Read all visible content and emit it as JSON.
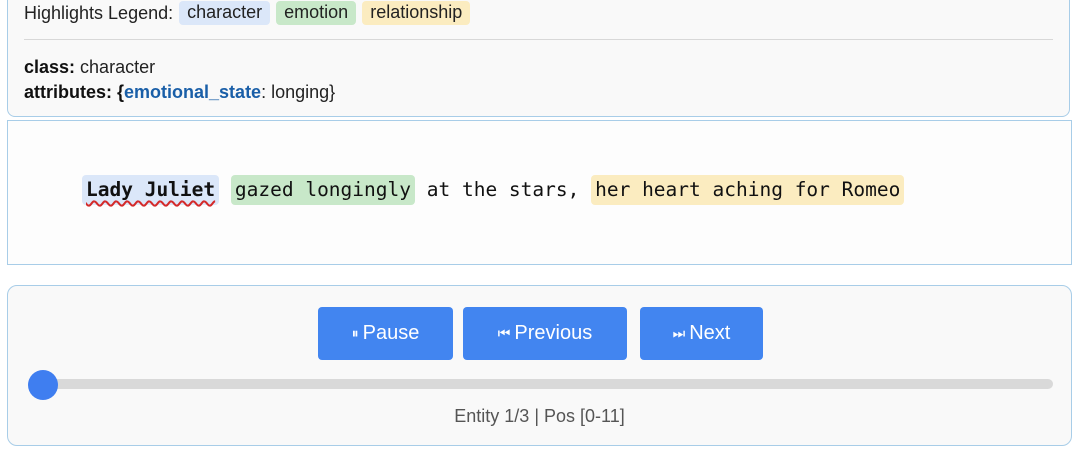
{
  "legend": {
    "label": "Highlights Legend:",
    "items": [
      {
        "label": "character",
        "color": "#dbe7f9"
      },
      {
        "label": "emotion",
        "color": "#c8e8c9"
      },
      {
        "label": "relationship",
        "color": "#fbecc0"
      }
    ]
  },
  "info": {
    "class_key": "class:",
    "class_value": " character",
    "attributes_key": "attributes:",
    "attr_open": " {",
    "attr_name": "emotional_state",
    "attr_value": ": longing}"
  },
  "sentence": {
    "character": "Lady Juliet",
    "emotion": "gazed longingly",
    "plain": " at the stars, ",
    "relationship": "her heart aching for Romeo"
  },
  "controls": {
    "pause_icon": "⏸",
    "pause_label": "Pause",
    "previous_icon": "⏮",
    "previous_label": "Previous",
    "next_icon": "⏭",
    "next_label": "Next",
    "progress": 0,
    "status": "Entity 1/3 | Pos [0-11]"
  },
  "colors": {
    "accent": "#4285f0",
    "panel_border": "#a8cde8",
    "underline": "#d42a2a"
  }
}
